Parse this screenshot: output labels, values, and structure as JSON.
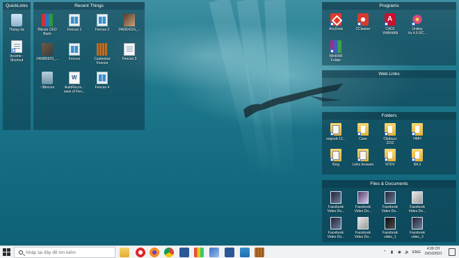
{
  "fences": {
    "quicklinks": {
      "title": "QuickLinks",
      "items": [
        {
          "label": "Thùng rác",
          "icon": "recycle-bin-icon"
        },
        {
          "label": "Income -",
          "label2": "Shortcut",
          "icon": "document-shortcut-icon"
        }
      ]
    },
    "recent": {
      "title": "Recent Things",
      "items": [
        {
          "label": "Bitcoin CEO",
          "label2": "Bank",
          "icon": "winrar-archive-icon"
        },
        {
          "label": "Fences 1",
          "icon": "fences-icon"
        },
        {
          "label": "Fences 2",
          "icon": "fences-icon"
        },
        {
          "label": "246354116_...",
          "icon": "photo-icon"
        },
        {
          "label": "246885923_...",
          "icon": "image-icon"
        },
        {
          "label": "Fences",
          "icon": "fences-icon"
        },
        {
          "label": "Customize",
          "label2": "Fences",
          "icon": "shutter-icon"
        },
        {
          "label": "Fences 3",
          "icon": "document-icon"
        },
        {
          "label": "~$fences",
          "icon": "document-icon"
        },
        {
          "label": "AutoRecov...",
          "label2": "save of Fen...",
          "icon": "word-autorecover-icon"
        },
        {
          "label": "Fences 4",
          "icon": "fences-icon"
        }
      ]
    },
    "programs": {
      "title": "Programs",
      "items": [
        {
          "label": "AnyDesk",
          "icon": "anydesk-icon"
        },
        {
          "label": "CCleaner",
          "icon": "ccleaner-icon"
        },
        {
          "label": "CAD2",
          "label2": "VIANHAN",
          "icon": "autocad-icon"
        },
        {
          "label": "Unikey",
          "label2": "Vu 4.6 RC...",
          "icon": "flower-icon"
        },
        {
          "label": "WinRAR",
          "label2": "Folder",
          "icon": "winrar-icon"
        }
      ]
    },
    "weblinks": {
      "title": "Web Links"
    },
    "folders": {
      "title": "Folders",
      "items": [
        {
          "label": "eegsub-12...",
          "icon": "folder-doc-icon"
        },
        {
          "label": "Case",
          "icon": "folder-icon"
        },
        {
          "label": "Clipbuzz",
          "label2": "2222",
          "icon": "folder-icon"
        },
        {
          "label": "HMH",
          "icon": "folder-icon"
        },
        {
          "label": "King",
          "icon": "folder-doc-icon"
        },
        {
          "label": "Links browser",
          "icon": "folder-doc-icon"
        },
        {
          "label": "NTDV",
          "icon": "folder-icon"
        },
        {
          "label": "RA 2",
          "icon": "folder-icon"
        }
      ]
    },
    "files": {
      "title": "Files & Documents",
      "items": [
        {
          "label": "Facebook",
          "label2": "Video Do...",
          "icon": "video-thumb-icon"
        },
        {
          "label": "Facebook",
          "label2": "Video Do...",
          "icon": "video-thumb-icon"
        },
        {
          "label": "Facebook",
          "label2": "Video Do...",
          "icon": "video-thumb-icon"
        },
        {
          "label": "Facebook",
          "label2": "Video Do...",
          "icon": "video-thumb-icon"
        },
        {
          "label": "Facebook",
          "label2": "Video Do...",
          "icon": "video-thumb-icon"
        },
        {
          "label": "Facebook",
          "label2": "Video Do...",
          "icon": "video-thumb-icon"
        },
        {
          "label": "Facebook",
          "label2": "video_1",
          "icon": "video-thumb-icon"
        },
        {
          "label": "Facebook",
          "label2": "video_3",
          "icon": "video-thumb-icon"
        }
      ]
    }
  },
  "taskbar": {
    "search_placeholder": "Nhập tại đây để tìm kiếm",
    "pinned": [
      "file-explorer-icon",
      "opera-icon",
      "firefox-icon",
      "chrome-icon",
      "app-icon",
      "paint-icon",
      "snipping-icon",
      "word-icon",
      "calendar-icon",
      "fences-taskbar-icon"
    ],
    "language": "ENG",
    "time": "4:39 CH",
    "date": "19/10/2021"
  }
}
